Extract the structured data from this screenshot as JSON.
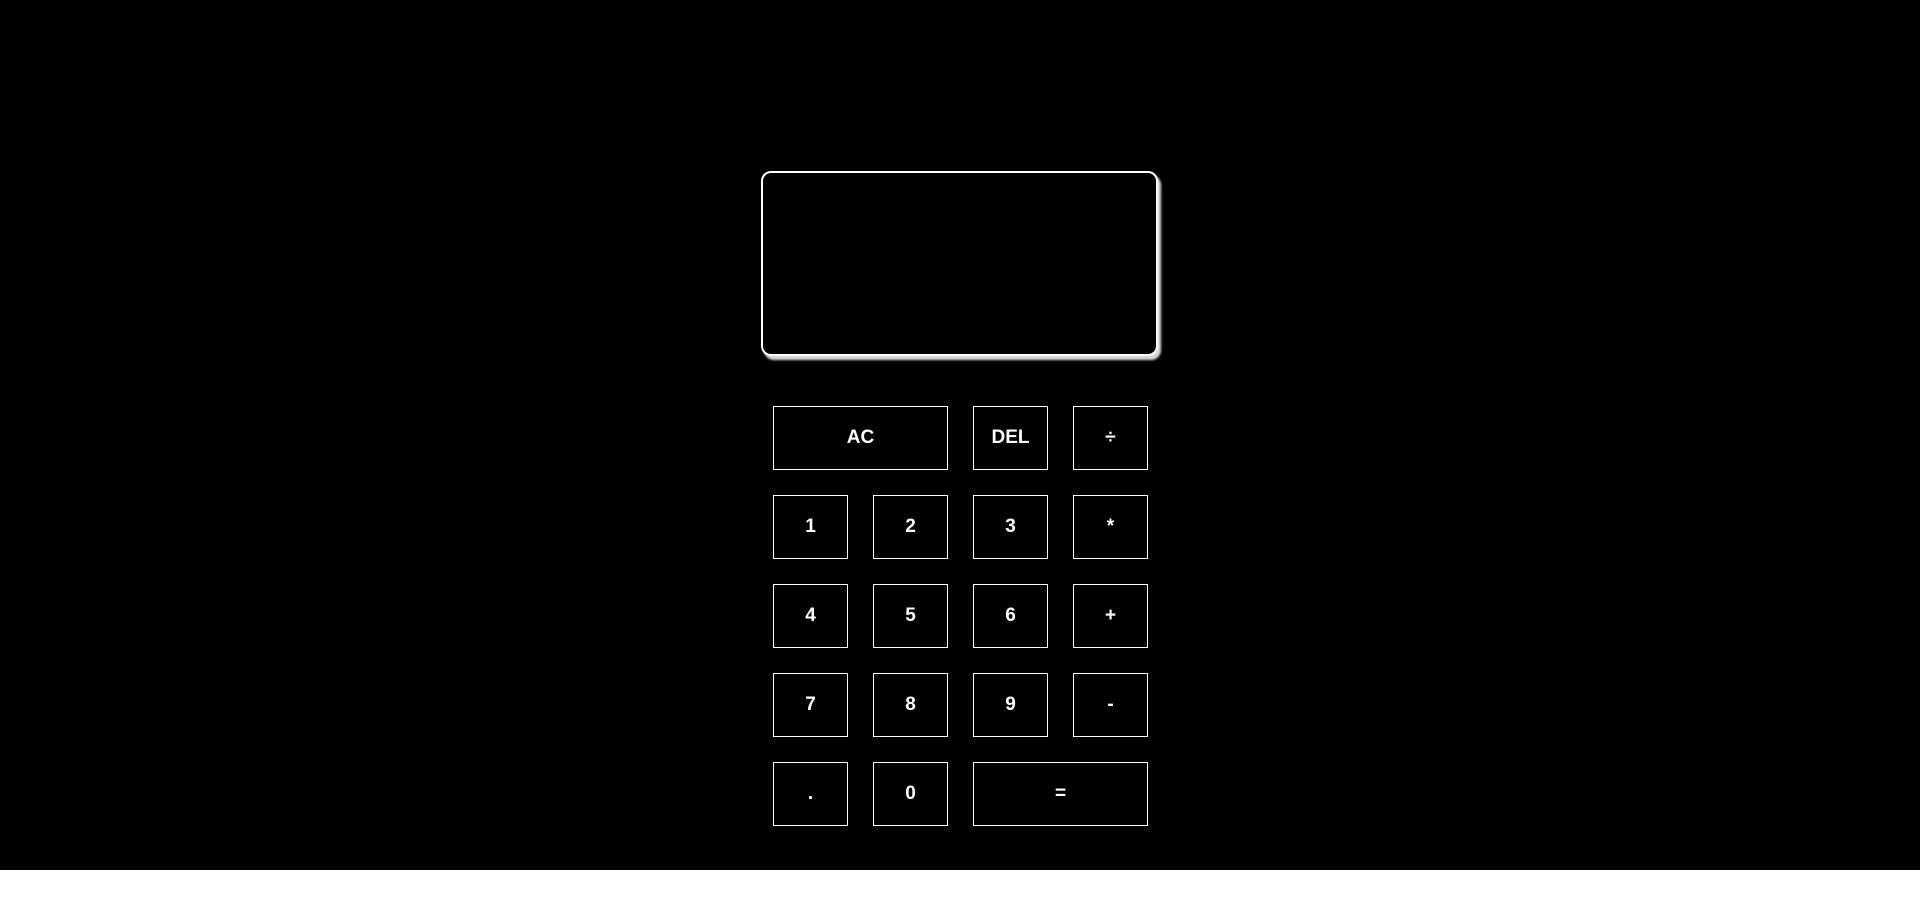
{
  "display": {
    "previous_operand": "",
    "current_operand": ""
  },
  "keys": {
    "ac": "AC",
    "del": "DEL",
    "divide": "÷",
    "one": "1",
    "two": "2",
    "three": "3",
    "multiply": "*",
    "four": "4",
    "five": "5",
    "six": "6",
    "plus": "+",
    "seven": "7",
    "eight": "8",
    "nine": "9",
    "minus": "-",
    "dot": ".",
    "zero": "0",
    "equals": "="
  },
  "colors": {
    "background": "#000000",
    "foreground": "#ffffff",
    "page_footer": "#ffffff"
  }
}
